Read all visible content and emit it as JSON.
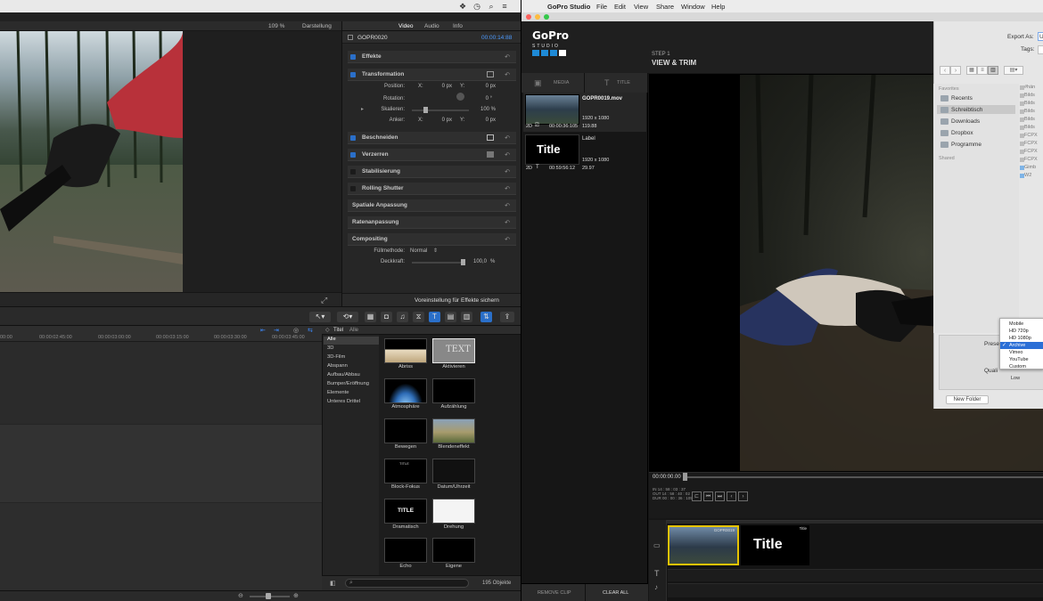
{
  "fcp": {
    "viewer": {
      "zoom": "109 %",
      "display": "Darstellung"
    },
    "inspector": {
      "tabs": [
        "Video",
        "Audio",
        "Info"
      ],
      "clip_name": "GOPR0020",
      "timecode": "00:00:14:88",
      "sections": {
        "effects": "Effekte",
        "transform": "Transformation",
        "crop": "Beschneiden",
        "distort": "Verzerren",
        "stabilize": "Stabilisierung",
        "rolling": "Rolling Shutter",
        "spatial": "Spatiale Anpassung",
        "rate": "Ratenanpassung",
        "compositing": "Compositing"
      },
      "params": {
        "position": "Position:",
        "x": "X:",
        "y": "Y:",
        "pos_x": "0 px",
        "pos_y": "0 px",
        "rotation": "Rotation:",
        "rotation_val": "0 °",
        "scale": "Skalieren:",
        "scale_val": "100 %",
        "anchor": "Anker:",
        "anchor_x": "0 px",
        "anchor_y": "0 px",
        "blend_mode": "Füllmethode:",
        "blend_val": "Normal",
        "opacity": "Deckkraft:",
        "opacity_val": "100,0",
        "opacity_unit": "%"
      },
      "save_preset": "Voreinstellung für Effekte sichern"
    },
    "timeline": {
      "ticks": [
        "00:00",
        "00:00:02:45:00",
        "00:00:03:00:00",
        "00:00:03:15:00",
        "00:00:03:30:00",
        "00:00:03:45:00"
      ]
    },
    "browser": {
      "header_title": "Titel",
      "header_all": "Alle",
      "categories": [
        "Alle",
        "3D",
        "3D-Film",
        "Abspann",
        "Aufbau/Abbau",
        "Bumper/Eröffnung",
        "Elemente",
        "Unteres Drittel"
      ],
      "items": [
        {
          "label": "Abriss"
        },
        {
          "label": "Aktivieren",
          "thumb": "TEXT"
        },
        {
          "label": "Atmosphäre"
        },
        {
          "label": "Aufzählung"
        },
        {
          "label": "Bewegen"
        },
        {
          "label": "Blendeneffekt"
        },
        {
          "label": "Block-Fokus",
          "thumb": "TITLE"
        },
        {
          "label": "Datum/Uhrzeit"
        },
        {
          "label": "Dramatisch",
          "thumb": "TITLE"
        },
        {
          "label": "Drehung"
        },
        {
          "label": "Echo"
        },
        {
          "label": "Eigene"
        }
      ],
      "count": "195 Objekte"
    }
  },
  "gopro": {
    "menu": [
      "GoPro Studio",
      "File",
      "Edit",
      "View",
      "Share",
      "Window",
      "Help"
    ],
    "logo": {
      "name": "GoPro",
      "sub": "STUDIO"
    },
    "tabs": [
      "MEDIA",
      "TITLE"
    ],
    "media_items": [
      {
        "name": "GOPR0019.mov",
        "res": "1920 x 1080",
        "mode": "2D",
        "duration": "00:00:36:105",
        "fps": "119.88"
      },
      {
        "name": "Label",
        "thumb": "Title",
        "res": "1920 x 1080",
        "mode": "2D",
        "duration": "00:59:56:12",
        "fps": "29.97"
      }
    ],
    "footer": {
      "remove": "REMOVE CLIP",
      "clear": "CLEAR ALL"
    },
    "step": {
      "label": "STEP 1",
      "title": "VIEW & TRIM"
    },
    "scrub": {
      "time": "00:00:00.00",
      "in": "IN  14 : 58 : 03 : 37",
      "out": "OUT 14 : 58 : 40 : 02",
      "dur": "DUR 00 : 00 : 36 : 105"
    },
    "timeline": {
      "clip1_label": "GOPR0019",
      "clip2_label": "Title",
      "clip2_text": "Title"
    },
    "export": {
      "export_as": "Export As:",
      "export_val": "U",
      "tags": "Tags:",
      "favorites_header": "Favorites",
      "favorites": [
        "Recents",
        "Schreibtisch",
        "Downloads",
        "Dropbox",
        "Programme"
      ],
      "shared_header": "Shared",
      "files": [
        "#hän",
        "Bilds",
        "Bilds",
        "Bilds",
        "Bilds",
        "Bilds",
        "FCPX",
        "FCPX",
        "FCPX",
        "FCPX",
        "Gimb",
        "W2"
      ],
      "preset_label": "Prese",
      "quality_label": "Quali",
      "presets": [
        "Mobile",
        "HD 720p",
        "HD 1080p",
        "Archive",
        "Vimeo",
        "YouTube",
        "Custom"
      ],
      "selected_preset": "Archive",
      "quality_low": "Low",
      "new_folder": "New Folder"
    }
  }
}
